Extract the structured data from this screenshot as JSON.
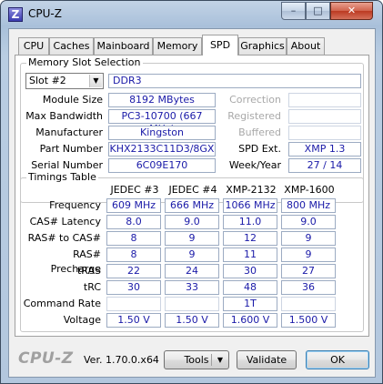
{
  "window": {
    "title": "CPU-Z",
    "icon_letter": "Z",
    "controls": {
      "minimize": "–",
      "maximize": "□",
      "close": "✕"
    }
  },
  "tabs": [
    "CPU",
    "Caches",
    "Mainboard",
    "Memory",
    "SPD",
    "Graphics",
    "About"
  ],
  "active_tab": "SPD",
  "memory_slot": {
    "group_title": "Memory Slot Selection",
    "slot_value": "Slot #2",
    "type_value": "DDR3",
    "labels": {
      "module_size": "Module Size",
      "max_bandwidth": "Max Bandwidth",
      "manufacturer": "Manufacturer",
      "part_number": "Part Number",
      "serial_number": "Serial Number",
      "correction": "Correction",
      "registered": "Registered",
      "buffered": "Buffered",
      "spd_ext": "SPD Ext.",
      "week_year": "Week/Year"
    },
    "values": {
      "module_size": "8192 MBytes",
      "max_bandwidth": "PC3-10700 (667 MHz)",
      "manufacturer": "Kingston",
      "part_number": "KHX2133C11D3/8GX",
      "serial_number": "6C09E170",
      "correction": "",
      "registered": "",
      "buffered": "",
      "spd_ext": "XMP 1.3",
      "week_year": "27 / 14"
    }
  },
  "timings": {
    "group_title": "Timings Table",
    "columns": [
      "JEDEC #3",
      "JEDEC #4",
      "XMP-2132",
      "XMP-1600"
    ],
    "rows": [
      {
        "label": "Frequency",
        "values": [
          "609 MHz",
          "666 MHz",
          "1066 MHz",
          "800 MHz"
        ]
      },
      {
        "label": "CAS# Latency",
        "values": [
          "8.0",
          "9.0",
          "11.0",
          "9.0"
        ]
      },
      {
        "label": "RAS# to CAS#",
        "values": [
          "8",
          "9",
          "12",
          "9"
        ]
      },
      {
        "label": "RAS# Precharge",
        "values": [
          "8",
          "9",
          "11",
          "9"
        ]
      },
      {
        "label": "tRAS",
        "values": [
          "22",
          "24",
          "30",
          "27"
        ]
      },
      {
        "label": "tRC",
        "values": [
          "30",
          "33",
          "48",
          "36"
        ]
      },
      {
        "label": "Command Rate",
        "values": [
          "",
          "",
          "1T",
          ""
        ]
      },
      {
        "label": "Voltage",
        "values": [
          "1.50 V",
          "1.50 V",
          "1.600 V",
          "1.500 V"
        ]
      }
    ]
  },
  "footer": {
    "brand": "CPU-Z",
    "version": "Ver. 1.70.0.x64",
    "tools_label": "Tools",
    "validate_label": "Validate",
    "ok_label": "OK"
  },
  "colors": {
    "value_text": "#1a1aa8",
    "title_bar": "#b3c7de"
  }
}
